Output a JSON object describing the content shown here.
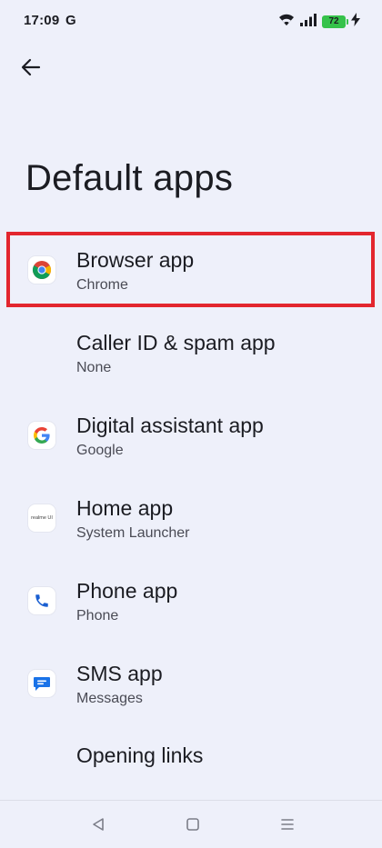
{
  "status_bar": {
    "time": "17:09",
    "g_label": "G",
    "battery": "72",
    "icons": [
      "wifi-icon",
      "signal-icon",
      "battery-icon",
      "charging-icon"
    ]
  },
  "header": {
    "back_icon": "arrow-back-icon",
    "title": "Default apps"
  },
  "items": [
    {
      "title": "Browser app",
      "subtitle": "Chrome",
      "icon": "chrome-icon"
    },
    {
      "title": "Caller ID & spam app",
      "subtitle": "None",
      "icon": ""
    },
    {
      "title": "Digital assistant app",
      "subtitle": "Google",
      "icon": "google-icon"
    },
    {
      "title": "Home app",
      "subtitle": "System Launcher",
      "icon": "realme-launcher-icon"
    },
    {
      "title": "Phone app",
      "subtitle": "Phone",
      "icon": "phone-icon"
    },
    {
      "title": "SMS app",
      "subtitle": "Messages",
      "icon": "messages-icon"
    },
    {
      "title": "Opening links",
      "subtitle": "",
      "icon": ""
    }
  ],
  "home_icon_text": "realme UI",
  "nav_bar": {
    "icons": [
      "back-triangle-icon",
      "home-square-icon",
      "menu-lines-icon"
    ]
  },
  "colors": {
    "background": "#eef0fa",
    "highlight": "#e3262e",
    "battery": "#35c24a"
  }
}
